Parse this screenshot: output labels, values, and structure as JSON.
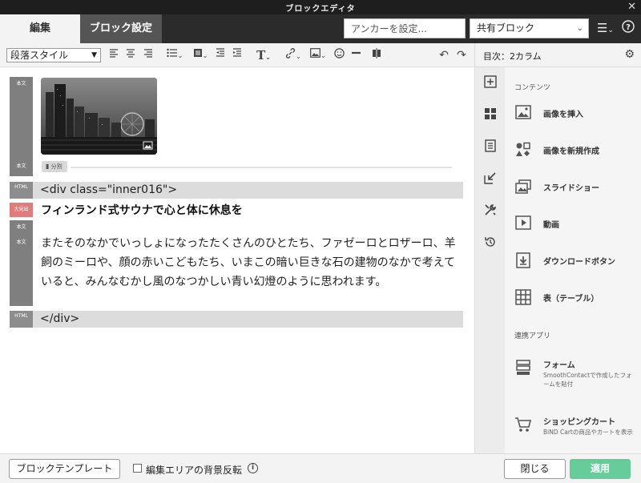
{
  "window": {
    "title": "ブロックエディタ"
  },
  "tabs": {
    "edit": "編集",
    "block_settings": "ブロック設定"
  },
  "header": {
    "anchor_placeholder": "アンカーを設定...",
    "shared_block": "共有ブロック"
  },
  "toolbar": {
    "paragraph_style": "段落スタイル"
  },
  "editor": {
    "labels": {
      "body": "本文",
      "html": "HTML",
      "heading": "大見出"
    },
    "split_label": "分割",
    "html_open": "<div class=\"inner016\">",
    "heading": "フィンランド式サウナで心と体に休息を",
    "paragraph": "またそのなかでいっしょになったたくさんのひとたち、ファゼーロとロザーロ、羊飼のミーロや、顔の赤いこどもたち、いまこの暗い巨きな石の建物のなかで考えていると、みんなむかし風のなつかしい青い幻燈のように思われます。",
    "html_close": "</div>"
  },
  "panel": {
    "title": "目次：2カラム",
    "contents_title": "コンテンツ",
    "items": [
      {
        "label": "画像を挿入",
        "icon": "image-icon"
      },
      {
        "label": "画像を新規作成",
        "icon": "shapes-icon"
      },
      {
        "label": "スライドショー",
        "icon": "slideshow-icon"
      },
      {
        "label": "動画",
        "icon": "video-icon"
      },
      {
        "label": "ダウンロードボタン",
        "icon": "download-icon"
      },
      {
        "label": "表（テーブル）",
        "icon": "table-icon"
      }
    ],
    "apps_title": "連携アプリ",
    "apps": [
      {
        "label": "フォーム",
        "sub": "SmoothContactで作成したフォームを貼付",
        "icon": "form-icon"
      },
      {
        "label": "ショッピングカート",
        "sub": "BiND Cartの商品やカートを表示",
        "icon": "cart-icon"
      }
    ]
  },
  "footer": {
    "template_button": "ブロックテンプレート",
    "invert_label": "編集エリアの背景反転",
    "close_button": "閉じる",
    "apply_button": "適用"
  },
  "colors": {
    "apply": "#66cc99",
    "heading_label": "#e27b7b",
    "header_bg": "#2b2b2b"
  }
}
